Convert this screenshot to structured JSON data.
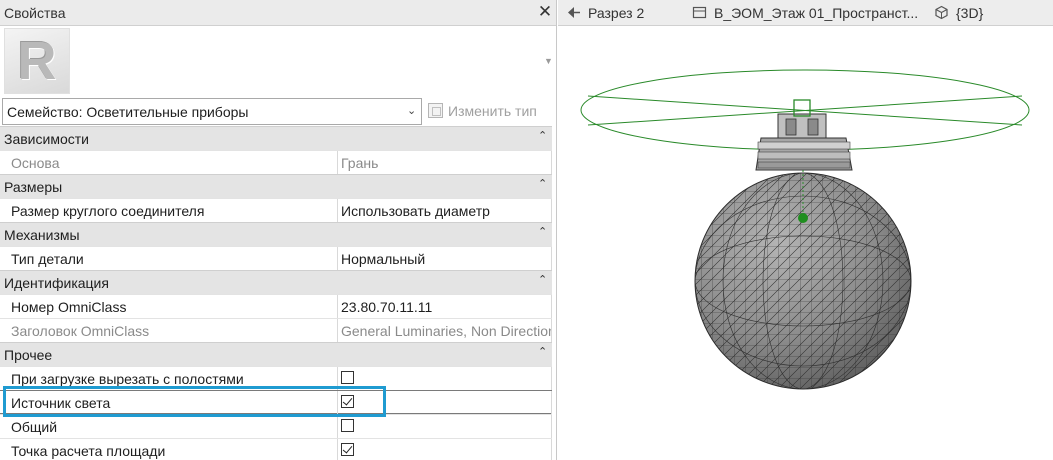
{
  "properties": {
    "title": "Свойства",
    "close_glyph": "✕",
    "logo_letter": "R",
    "family_selector": "Семейство: Осветительные приборы",
    "edit_type_label": "Изменить тип",
    "groups": [
      {
        "label": "Зависимости",
        "toggle": "⌃",
        "rows": [
          {
            "name": "Основа",
            "value": "Грань",
            "readonly": true
          }
        ]
      },
      {
        "label": "Размеры",
        "toggle": "⌃",
        "rows": [
          {
            "name": "Размер круглого соединителя",
            "value": "Использовать диаметр",
            "readonly": false
          }
        ]
      },
      {
        "label": "Механизмы",
        "toggle": "⌃",
        "rows": [
          {
            "name": "Тип детали",
            "value": "Нормальный",
            "readonly": false
          }
        ]
      },
      {
        "label": "Идентификация",
        "toggle": "⌃",
        "rows": [
          {
            "name": "Номер OmniClass",
            "value": "23.80.70.11.11",
            "readonly": false
          },
          {
            "name": "Заголовок OmniClass",
            "value": "General Luminaries, Non Directional",
            "readonly": true
          }
        ]
      },
      {
        "label": "Прочее",
        "toggle": "⌃",
        "rows": [
          {
            "name": "При загрузке вырезать с полостями",
            "checkbox": true,
            "checked": false
          },
          {
            "name": "Источник света",
            "checkbox": true,
            "checked": true,
            "selected": true
          },
          {
            "name": "Общий",
            "checkbox": true,
            "checked": false
          },
          {
            "name": "Точка расчета площади",
            "checkbox": true,
            "checked": true
          }
        ]
      }
    ]
  },
  "view_tabs": [
    {
      "label": "Разрез 2",
      "icon": "section-view-icon"
    },
    {
      "label": "В_ЭОМ_Этаж 01_Пространст...",
      "icon": "floor-plan-icon"
    },
    {
      "label": "{3D}",
      "icon": "3d-view-icon"
    }
  ],
  "colors": {
    "highlight": "#1f9bd1",
    "light_source_green": "#2a8a2a",
    "sphere": "#8c8c8c"
  }
}
